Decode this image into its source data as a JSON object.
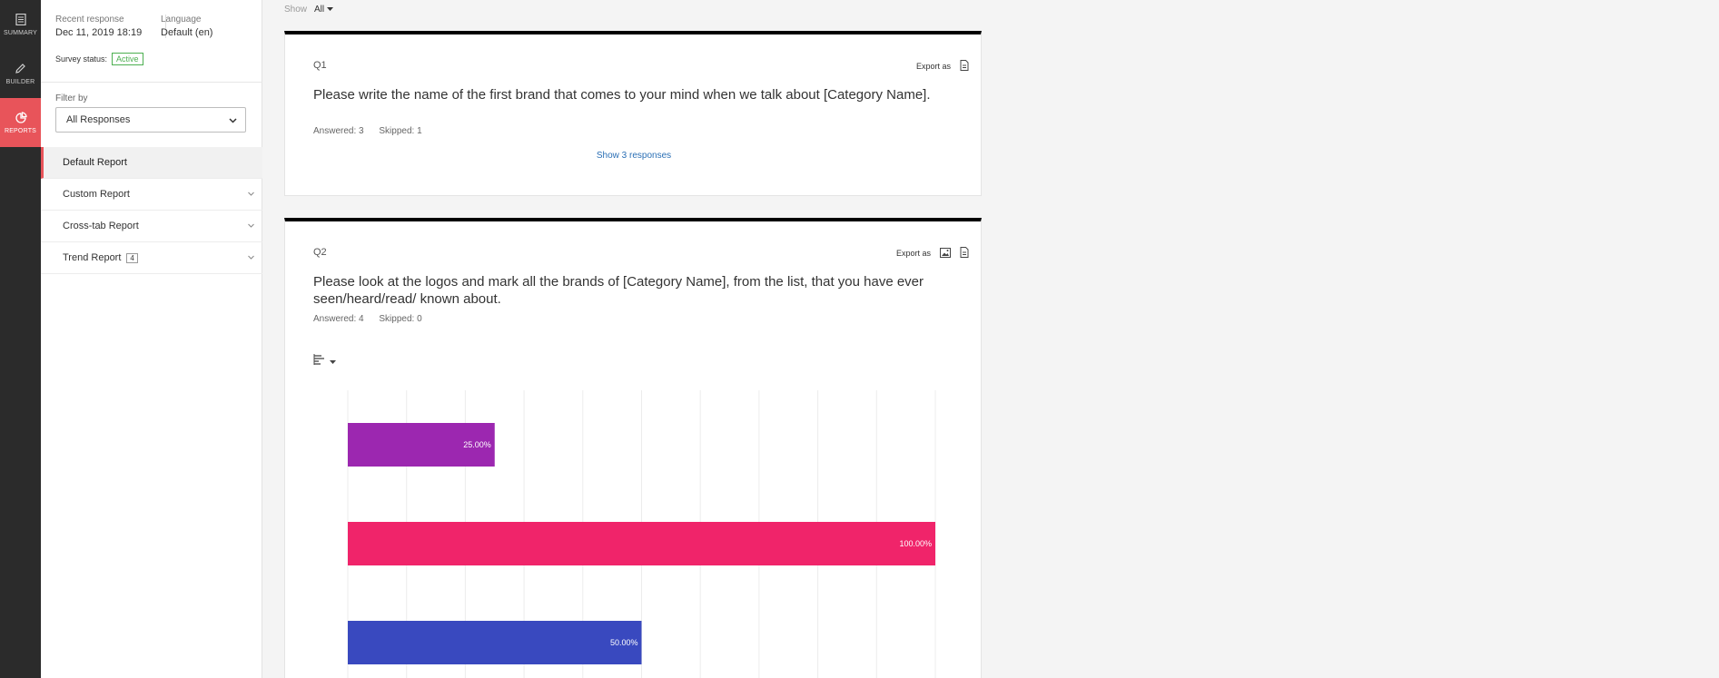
{
  "rail": {
    "items": [
      {
        "label": "SUMMARY",
        "icon": "summary-icon"
      },
      {
        "label": "BUILDER",
        "icon": "pencil-icon"
      },
      {
        "label": "REPORTS",
        "icon": "pie-chart-icon"
      }
    ],
    "active_color": "#e8545a"
  },
  "sidebar": {
    "recent_response_label": "Recent response",
    "recent_response_value": "Dec 11, 2019 18:19",
    "language_label": "Language",
    "language_value": "Default (en)",
    "status_label": "Survey status:",
    "status_value": "Active",
    "filter_label": "Filter by",
    "filter_value": "All Responses",
    "nav": [
      {
        "label": "Default Report"
      },
      {
        "label": "Custom Report"
      },
      {
        "label": "Cross-tab Report"
      },
      {
        "label": "Trend Report",
        "badge": "4"
      }
    ]
  },
  "main": {
    "show_label": "Show",
    "show_value": "All",
    "export_label": "Export as",
    "questions": [
      {
        "number": "Q1",
        "text": "Please write the name of the first brand that comes to your mind when we talk about [Category Name].",
        "answered": "Answered: 3",
        "skipped": "Skipped: 1",
        "show_responses": "Show 3 responses"
      },
      {
        "number": "Q2",
        "text": "Please look at the logos and mark all the brands of [Category Name], from the list, that you have ever seen/heard/read/ known about.",
        "answered": "Answered: 4",
        "skipped": "Skipped: 0"
      }
    ]
  },
  "chart_data": {
    "type": "bar",
    "orientation": "horizontal",
    "xlim": [
      0,
      100
    ],
    "grid": true,
    "series": [
      {
        "values": [
          25,
          100,
          50
        ],
        "labels": [
          "25.00%",
          "100.00%",
          "50.00%"
        ],
        "colors": [
          "#9c27b0",
          "#f0246a",
          "#3949bf"
        ]
      }
    ]
  }
}
